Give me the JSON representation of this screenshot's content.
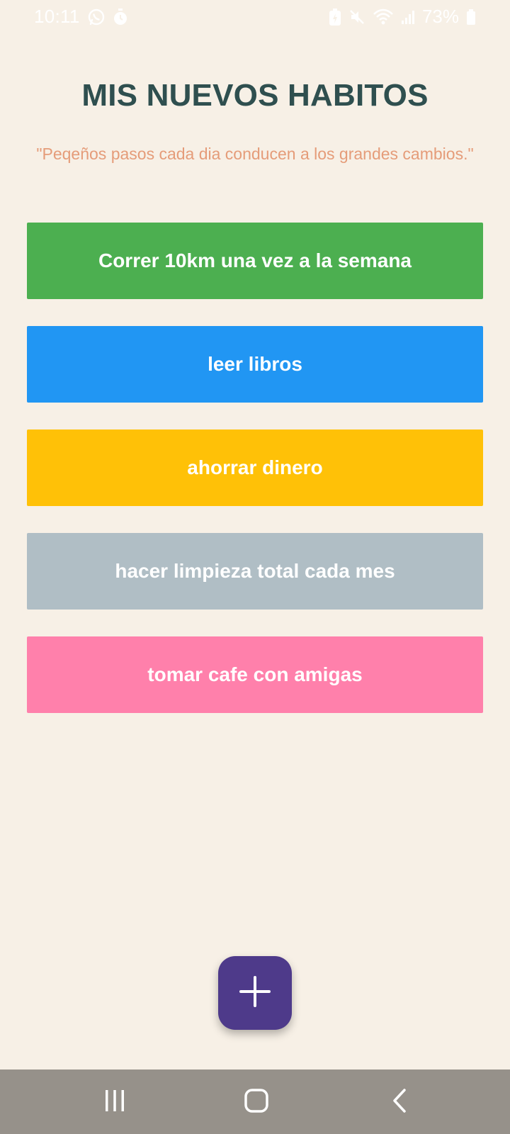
{
  "status_bar": {
    "time": "10:11",
    "battery": "73%",
    "left_icons": [
      "whatsapp-icon",
      "timer-icon"
    ],
    "right_icons": [
      "battery-saver-icon",
      "mute-icon",
      "wifi-icon",
      "signal-icon",
      "battery-icon"
    ]
  },
  "header": {
    "title": "MIS NUEVOS HABITOS",
    "quote": "\"Peqeños pasos cada dia conducen a los grandes cambios.\""
  },
  "habits": [
    {
      "label": "Correr 10km una vez a la semana",
      "color": "#4CAF50"
    },
    {
      "label": "leer libros",
      "color": "#2196F3"
    },
    {
      "label": "ahorrar dinero",
      "color": "#FFC107"
    },
    {
      "label": "hacer limpieza total cada mes",
      "color": "#B0BEC5"
    },
    {
      "label": "tomar cafe con amigas",
      "color": "#FF80AB"
    }
  ],
  "fab": {
    "icon": "plus-icon",
    "color": "#4E3A8A"
  },
  "nav_bar": {
    "icons": [
      "recent-apps-icon",
      "home-icon",
      "back-icon"
    ]
  },
  "colors": {
    "background": "#F7F0E6",
    "title": "#2F4F4F",
    "quote": "#E59C79",
    "nav_bar": "#96918A"
  }
}
